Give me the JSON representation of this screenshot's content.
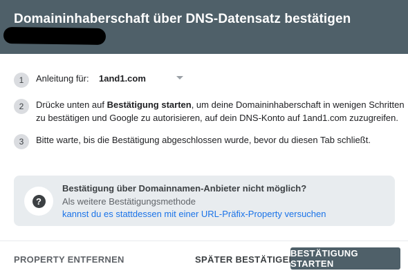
{
  "dialog": {
    "title": "Domaininhaberschaft über DNS-Datensatz bestätigen"
  },
  "steps": [
    {
      "number": "1",
      "label": "Anleitung für:",
      "provider_value": "1and1.com"
    },
    {
      "number": "2",
      "line1_before": "Drücke unten auf ",
      "line1_bold": "Bestätigung starten",
      "line1_after": ", um deine Domaininhaberschaft in wenigen Schritten",
      "line2": "zu bestätigen und Google zu autorisieren, auf dein DNS-Konto auf 1and1.com zuzugreifen."
    },
    {
      "number": "3",
      "text": "Bitte warte, bis die Bestätigung abgeschlossen wurde, bevor du diesen Tab schließt."
    }
  ],
  "info": {
    "icon": "question-mark-icon",
    "title": "Bestätigung über Domainnamen-Anbieter nicht möglich?",
    "subtitle": "Als weitere Bestätigungsmethode",
    "link": "kannst du es stattdessen mit einer URL-Präfix-Property versuchen"
  },
  "buttons": {
    "remove": "PROPERTY ENTFERNEN",
    "later": "SPÄTER BESTÄTIGEN",
    "start": "BESTÄTIGUNG STARTEN"
  },
  "colors": {
    "header_bg": "#4f6069",
    "link": "#1a73e8",
    "info_bg": "#e8ecef"
  }
}
